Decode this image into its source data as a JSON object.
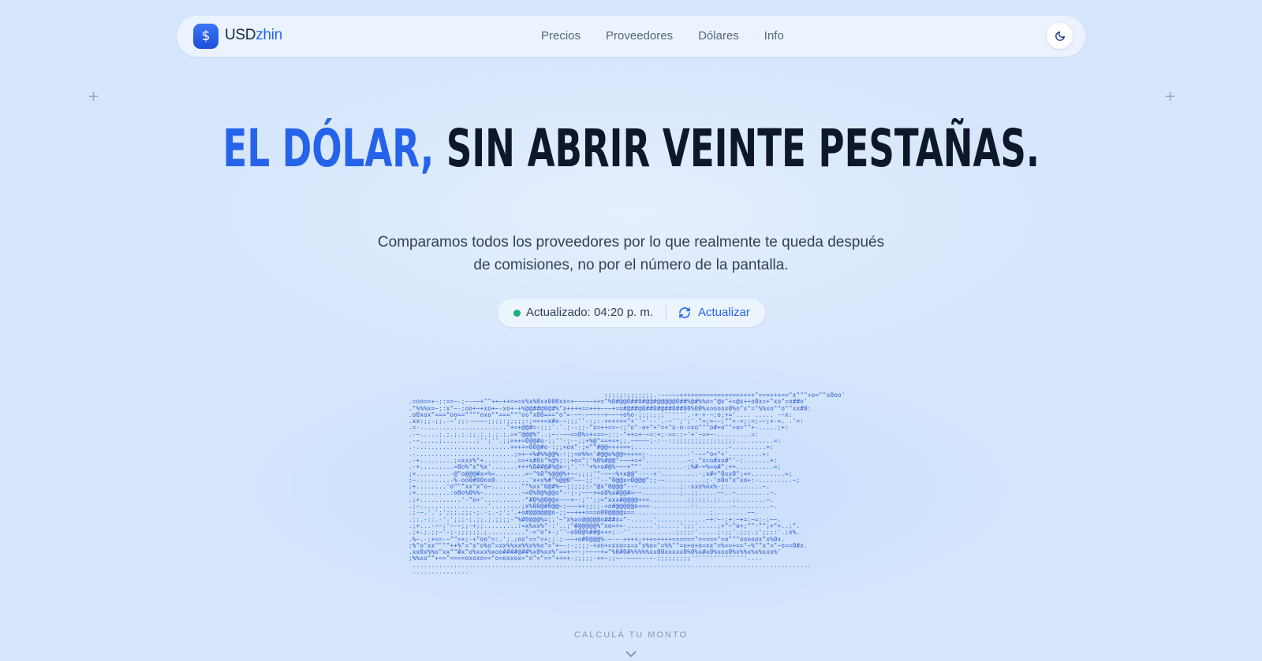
{
  "brand": {
    "prefix": "USD",
    "suffix": "zhin",
    "badge_symbol": "$"
  },
  "nav": {
    "links": [
      "Precios",
      "Proveedores",
      "Dólares",
      "Info"
    ]
  },
  "theme_toggle": {
    "icon": "moon-icon"
  },
  "hero": {
    "title_accent": "EL DÓLAR,",
    "title_rest": "SIN ABRIR VEINTE PESTAÑAS."
  },
  "subtitle": {
    "line1": "Comparamos todos los proveedores por lo que realmente te queda después",
    "line2": "de comisiones, no por el número de la pantalla."
  },
  "status": {
    "label": "Actualizado:",
    "time": "04:20 p. m.",
    "refresh_label": "Actualizar",
    "indicator_color": "#22b07a"
  },
  "ascii_art": {
    "rows": [
      "                                                    :;::;:;;;:;;;.-~~~~~++++============++=+\"===+++==\"x\"\"\"+o=\"\"o0oo'",
      ".=oo==+-;:==~-;~-~~+\"\"++~++=+=x%x%0xx000xx=+~~~~~++=\"%0#@@0##0#@@#@@@@@0##%@#%%o=\"@x\"+=@x++o0x=+\"xo\"=o##o'",
      ".\"%%%x=~;:x\"~-;oo+~+xo+~-xo+-+%@@##@0@#%\"x++++==+++~~~+=o#@##@0##0#@##0##00%00%xoooox0%o\"x\"=\"%%xo\"\"o\"\"xx#0:",
      ".o0xox\"===\"oo==\"\"\"\"oxo\"\"===\"\"\"oo\"x00===\"o\"=-~~-~~~~~+~~~+o%o-;;;:;:;''''''.-+-+-~;o;+='.... ..... -~x:",
      ".xx:;;-;;.-~';;:-~~~~;;;;:;;;;;:;==+=x#o-~;;;''-:;:-+=+++=\"+''~'--'.-~'';';'-\"=;=~~;\"\"+-=;:=;~~;+-=. .'=:",
      ".=-.......................\"+=+@@#=-;;;'.'.;--;;-\"x=++==~:;\"o\"-o+\"+\"=+\"x-o-=xo\"\"\"o#+o\"\"+o=\"\"+-.....;+:",
      ".-~.....;.;.;.;.;;.;.;.;.;.=+\"@@@%\"..;~--~~==0%=+===~;:;-\"++=+-~=:+;-==:;~'+'~=+~-.........=:",
      ".-~.....;.........;'';''.;;=++=0@@#o-:;''-;--;;+%@\"==+=+;;.~~~~~;-:--:;;;;;;;;;;;;;;;;;..........=:",
      ".-.........................+=++=00@#o-:;;+ox\"-;=\"\"#@@=+++==;.........................~.........=:",
      ".-..........................;=+~+%#%%@@%-:;;=o%%='#@@o%@@=+++=;-..........-'-~~\"o=\"+'.........+:",
      ".-+.........;=xxx%\"+.........==+x#0x\"%@%;:;+o=\";'%0%#@@\"~~~+=+'...........~;.\"x=o#xo#\"'-;.......+:",
      ".-+.........=0o%\"x\"%x'.......+++%0##@#%@x~;'.'''+%+o#@%~~~+\"\"'...........-;%#~+%=o#\";++..........=;",
      ";+.........-@\"o@@@#x=%=........=~\"%0\"%@@@%+~~;;;;'\"-~~~%+x@@\"----+'..........-;x#+\"0xx0\";=+.........=;",
      ";~.........-%-oo0#00ox0.........'x+x%#\"%@@0\"~~-;;''--\"0@@x=0@@@\";;-~...........;-'o0o\"x\"xo+:-.........~;",
      ";+........'o\"\"\"xx\"x\"o~........\"\"%xx\"0@#%~-;;;;;;-\"@x\"0@@@\"---...........;.-xxo%ox%-;:.........~.",
      ":+.........:o0o%0%%~..........~=0%0@%@@o\"--;-;~~~+=o0%x#@@#=~~..........;..;;.....~~..~.........~.",
      ".;+...........'-\"o+'..........-\"#0%@0@@x~~~+~-;'';;=\"xxx#@@@@++=..........:;::;:.;:...;:.......~.",
      ".;~..................'........;x%00@#0@@~;~~~++;;;;-+o#@@@@@o+==-..........::.........~.........~.",
      ".;-~.'.';';;;.;;;-;.-;.-;';'.+o#@@@@@@o-;;~~+++===o00@@@@x==....................;.........~~.",
      ".;:.-::.-'.';;;-;.;;.;.;;;;-\"%#0@@@%=;;'~\"x%xo@@@@@o###x=\"-......'.............~+:~-;+:~+=:~=:-;~~.",
      ".;+...-~-;'~-~;;-+;;.........:=x%xx%\"-:'..;\"#@@@@@%\"xo=+=-.......';.....';;;'.....;+\"~\"o+;\"\"-\"\";+\"+..;\".",
      ".;+.;.;;~'-;-;;;;;;.;..........\"-=\"o\"+-;''~o00@%##@++=;.-''............;;;;:'.....;:;;'.;;;.;';;;:'.;x%.",
      ".%~.-;+==-~\"\"=+;-+\"oo\"=:.';.;oo\"==\"=+;;.;-~~+o#0@@@%-~-~-++++;+++=++++======\"=====\"=o\"\"\"ooooox\"x%0x.",
      ";%\"o\"xx\"\"\"\"++%\"=\"x\"o%o\"=xx%%xx%%x%%o\"=\"+~-:-;;;;-+xo+=xxo=x=x\"x%o=\"=%%\"\"=o+o+o=xx\"=%==+==\"~%\"\"x\"=\"~o==0#x.",
      ".xx0x%%o\"xx\"\"#x\"o%xxx%xoo####@##%x0%xx%\"==+~~-;~~~~+=\"%0#0#%%%%%xx00xxxxx0%0%x#x0%xox0%x%%x%x%xxo%'",
      ";%%xo\"\"+==\"====oxoxo==\"o=oxxox=\"o\"=\"==\"++=+-;;;;;-+=~;;~~-~~~~--~-;;;;;;;;;'''''''''''''''....",
      " ..........................................................................................................",
      " ..............."
    ]
  },
  "calculator": {
    "label": "CALCULÁ TU MONTO"
  }
}
